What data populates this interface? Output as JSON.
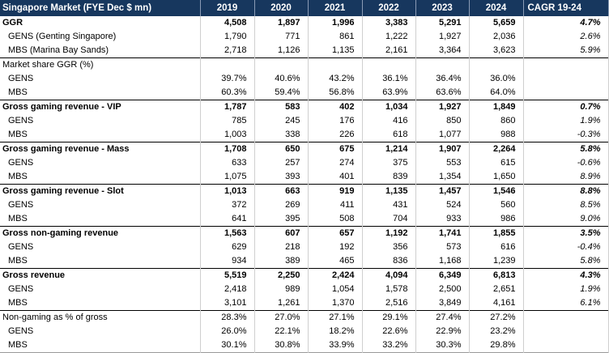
{
  "table": {
    "headers": [
      "Singapore Market (FYE Dec $ mn)",
      "2019",
      "2020",
      "2021",
      "2022",
      "2023",
      "2024",
      "CAGR 19-24"
    ],
    "rows": [
      {
        "type": "header",
        "group": false,
        "label": "GGR",
        "values": [
          "4,508",
          "1,897",
          "1,996",
          "3,383",
          "5,291",
          "5,659"
        ],
        "cagr": "4.7%"
      },
      {
        "type": "sub",
        "label": "GENS (Genting Singapore)",
        "values": [
          "1,790",
          "771",
          "861",
          "1,222",
          "1,927",
          "2,036"
        ],
        "cagr": "2.6%"
      },
      {
        "type": "sub",
        "label": "MBS (Marina Bay Sands)",
        "values": [
          "2,718",
          "1,126",
          "1,135",
          "2,161",
          "3,364",
          "3,623"
        ],
        "cagr": "5.9%"
      },
      {
        "type": "plain",
        "group": true,
        "label": "Market share GGR (%)",
        "values": [
          "",
          "",
          "",
          "",
          "",
          ""
        ],
        "cagr": ""
      },
      {
        "type": "sub",
        "label": "GENS",
        "values": [
          "39.7%",
          "40.6%",
          "43.2%",
          "36.1%",
          "36.4%",
          "36.0%"
        ],
        "cagr": ""
      },
      {
        "type": "sub",
        "label": "MBS",
        "values": [
          "60.3%",
          "59.4%",
          "56.8%",
          "63.9%",
          "63.6%",
          "64.0%"
        ],
        "cagr": ""
      },
      {
        "type": "header",
        "group": true,
        "label": "Gross gaming revenue - VIP",
        "values": [
          "1,787",
          "583",
          "402",
          "1,034",
          "1,927",
          "1,849"
        ],
        "cagr": "0.7%"
      },
      {
        "type": "sub",
        "label": "GENS",
        "values": [
          "785",
          "245",
          "176",
          "416",
          "850",
          "860"
        ],
        "cagr": "1.9%"
      },
      {
        "type": "sub",
        "label": "MBS",
        "values": [
          "1,003",
          "338",
          "226",
          "618",
          "1,077",
          "988"
        ],
        "cagr": "-0.3%"
      },
      {
        "type": "header",
        "group": true,
        "label": "Gross gaming revenue - Mass",
        "values": [
          "1,708",
          "650",
          "675",
          "1,214",
          "1,907",
          "2,264"
        ],
        "cagr": "5.8%"
      },
      {
        "type": "sub",
        "label": "GENS",
        "values": [
          "633",
          "257",
          "274",
          "375",
          "553",
          "615"
        ],
        "cagr": "-0.6%"
      },
      {
        "type": "sub",
        "label": "MBS",
        "values": [
          "1,075",
          "393",
          "401",
          "839",
          "1,354",
          "1,650"
        ],
        "cagr": "8.9%"
      },
      {
        "type": "header",
        "group": true,
        "label": "Gross gaming revenue - Slot",
        "values": [
          "1,013",
          "663",
          "919",
          "1,135",
          "1,457",
          "1,546"
        ],
        "cagr": "8.8%"
      },
      {
        "type": "sub",
        "label": "GENS",
        "values": [
          "372",
          "269",
          "411",
          "431",
          "524",
          "560"
        ],
        "cagr": "8.5%"
      },
      {
        "type": "sub",
        "label": "MBS",
        "values": [
          "641",
          "395",
          "508",
          "704",
          "933",
          "986"
        ],
        "cagr": "9.0%"
      },
      {
        "type": "header",
        "group": true,
        "label": "Gross non-gaming revenue",
        "values": [
          "1,563",
          "607",
          "657",
          "1,192",
          "1,741",
          "1,855"
        ],
        "cagr": "3.5%"
      },
      {
        "type": "sub",
        "label": "GENS",
        "values": [
          "629",
          "218",
          "192",
          "356",
          "573",
          "616"
        ],
        "cagr": "-0.4%"
      },
      {
        "type": "sub",
        "label": "MBS",
        "values": [
          "934",
          "389",
          "465",
          "836",
          "1,168",
          "1,239"
        ],
        "cagr": "5.8%"
      },
      {
        "type": "header",
        "group": true,
        "label": "Gross revenue",
        "values": [
          "5,519",
          "2,250",
          "2,424",
          "4,094",
          "6,349",
          "6,813"
        ],
        "cagr": "4.3%"
      },
      {
        "type": "sub",
        "label": "GENS",
        "values": [
          "2,418",
          "989",
          "1,054",
          "1,578",
          "2,500",
          "2,651"
        ],
        "cagr": "1.9%"
      },
      {
        "type": "sub",
        "label": "MBS",
        "values": [
          "3,101",
          "1,261",
          "1,370",
          "2,516",
          "3,849",
          "4,161"
        ],
        "cagr": "6.1%"
      },
      {
        "type": "plain",
        "group": true,
        "label": "Non-gaming as % of gross",
        "values": [
          "28.3%",
          "27.0%",
          "27.1%",
          "29.1%",
          "27.4%",
          "27.2%"
        ],
        "cagr": ""
      },
      {
        "type": "sub",
        "label": "GENS",
        "values": [
          "26.0%",
          "22.1%",
          "18.2%",
          "22.6%",
          "22.9%",
          "23.2%"
        ],
        "cagr": ""
      },
      {
        "type": "sub",
        "label": "MBS",
        "values": [
          "30.1%",
          "30.8%",
          "33.9%",
          "33.2%",
          "30.3%",
          "29.8%"
        ],
        "cagr": ""
      }
    ]
  }
}
